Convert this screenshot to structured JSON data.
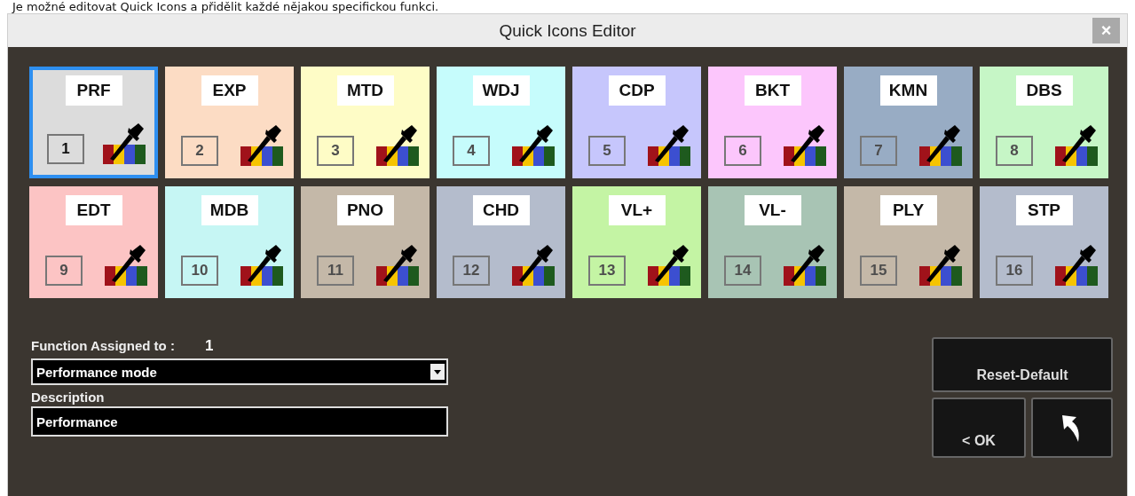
{
  "caption": "Je možné editovat Quick Icons a přidělit každé nějakou specifickou funkci.",
  "window": {
    "title": "Quick Icons Editor",
    "close": "×"
  },
  "icons": [
    {
      "label": "PRF",
      "number": "1",
      "color": "#dcdcdc",
      "selected": true
    },
    {
      "label": "EXP",
      "number": "2",
      "color": "#fcdcc4",
      "selected": false
    },
    {
      "label": "MTD",
      "number": "3",
      "color": "#fefcc6",
      "selected": false
    },
    {
      "label": "WDJ",
      "number": "4",
      "color": "#c6fcfc",
      "selected": false
    },
    {
      "label": "CDP",
      "number": "5",
      "color": "#c6c6fc",
      "selected": false
    },
    {
      "label": "BKT",
      "number": "6",
      "color": "#fcc6fc",
      "selected": false
    },
    {
      "label": "KMN",
      "number": "7",
      "color": "#98acc4",
      "selected": false
    },
    {
      "label": "DBS",
      "number": "8",
      "color": "#c6f6c6",
      "selected": false
    },
    {
      "label": "EDT",
      "number": "9",
      "color": "#fcc4c4",
      "selected": false
    },
    {
      "label": "MDB",
      "number": "10",
      "color": "#c6f6f4",
      "selected": false
    },
    {
      "label": "PNO",
      "number": "11",
      "color": "#c4b8a8",
      "selected": false
    },
    {
      "label": "CHD",
      "number": "12",
      "color": "#b4bccc",
      "selected": false
    },
    {
      "label": "VL+",
      "number": "13",
      "color": "#c4f4a4",
      "selected": false
    },
    {
      "label": "VL-",
      "number": "14",
      "color": "#a8c4b4",
      "selected": false
    },
    {
      "label": "PLY",
      "number": "15",
      "color": "#c4b8a8",
      "selected": false
    },
    {
      "label": "STP",
      "number": "16",
      "color": "#b4bccc",
      "selected": false
    }
  ],
  "function_assigned": {
    "label": "Function Assigned to :",
    "value": "1"
  },
  "function_select": {
    "value": "Performance mode"
  },
  "description": {
    "label": "Description",
    "value": "Performance"
  },
  "buttons": {
    "reset": "Reset-Default",
    "ok": "< OK"
  }
}
